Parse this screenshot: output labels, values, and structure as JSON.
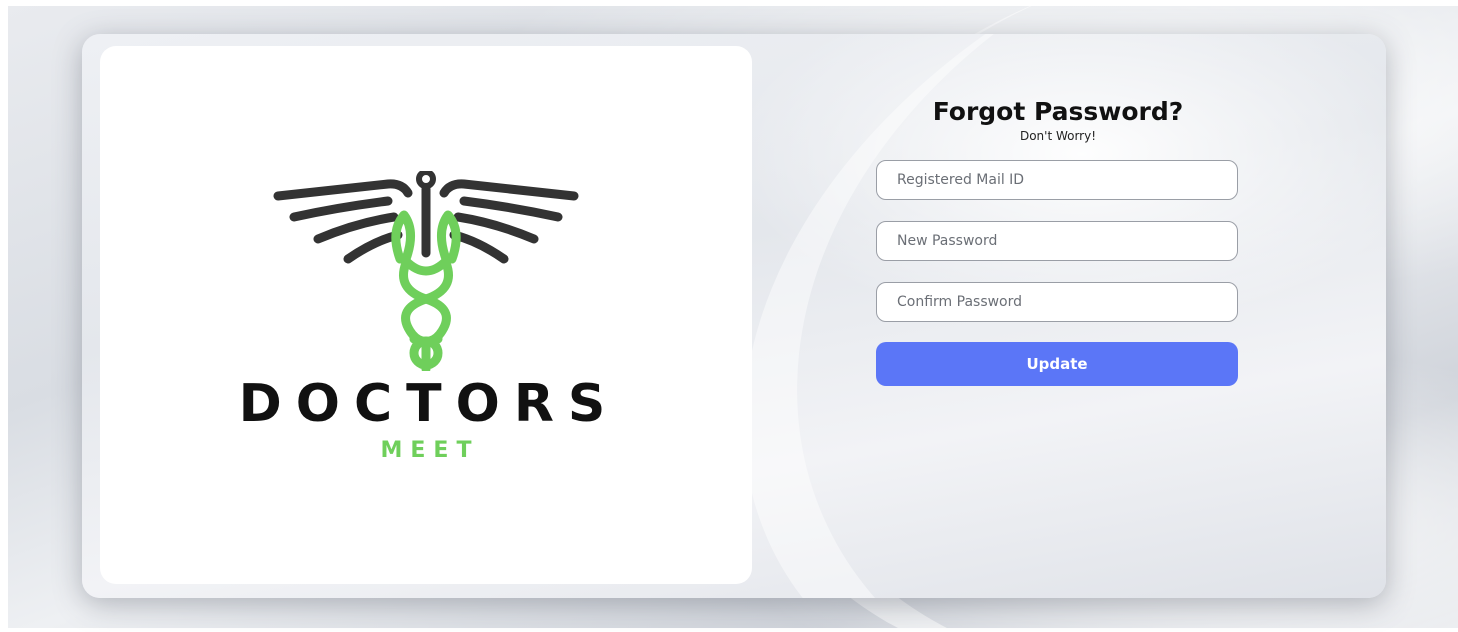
{
  "brand": {
    "name": "DOCTORS",
    "sub": "MEET"
  },
  "form": {
    "title": "Forgot Password?",
    "subtitle": "Don't Worry!",
    "email_placeholder": "Registered Mail ID",
    "new_password_placeholder": "New Password",
    "confirm_password_placeholder": "Confirm Password",
    "submit_label": "Update"
  },
  "colors": {
    "accent": "#5b76f7",
    "brand_green": "#6fcf5b",
    "brand_dark": "#111111"
  },
  "icons": {
    "logo": "caduceus-wings-icon"
  }
}
